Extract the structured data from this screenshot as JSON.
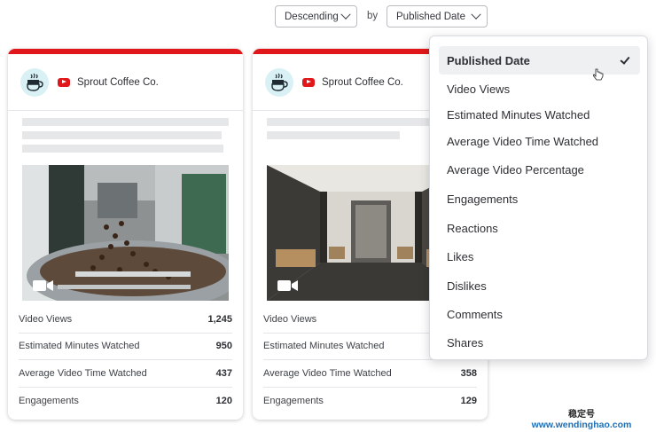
{
  "sort_controls": {
    "order_value": "Descending",
    "by_label": "by",
    "sort_value": "Published Date"
  },
  "cards": [
    {
      "brand": "Sprout Coffee Co.",
      "stats": [
        {
          "label": "Video Views",
          "value": "1,245"
        },
        {
          "label": "Estimated Minutes Watched",
          "value": "950"
        },
        {
          "label": "Average Video Time Watched",
          "value": "437"
        },
        {
          "label": "Engagements",
          "value": "120"
        }
      ]
    },
    {
      "brand": "Sprout Coffee Co.",
      "stats": [
        {
          "label": "Video Views",
          "value": ""
        },
        {
          "label": "Estimated Minutes Watched",
          "value": ""
        },
        {
          "label": "Average Video Time Watched",
          "value": "358"
        },
        {
          "label": "Engagements",
          "value": "129"
        }
      ]
    }
  ],
  "dropdown": {
    "items": [
      "Published Date",
      "Video Views",
      "Estimated Minutes Watched",
      "Average Video Time Watched",
      "Average Video Percentage",
      "Engagements",
      "Reactions",
      "Likes",
      "Dislikes",
      "Comments",
      "Shares"
    ],
    "selected_index": 0
  },
  "watermark": {
    "line1": "稳定号",
    "line2": "www.wendinghao.com"
  },
  "colors": {
    "accent_red": "#e1181b",
    "avatar_bg": "#d9f1f4",
    "watermark_url": "#1d6fb8"
  },
  "icons": {
    "platform": "youtube-icon",
    "avatar": "coffee-cup-icon",
    "media": "video-camera-icon",
    "selected": "check-icon"
  }
}
